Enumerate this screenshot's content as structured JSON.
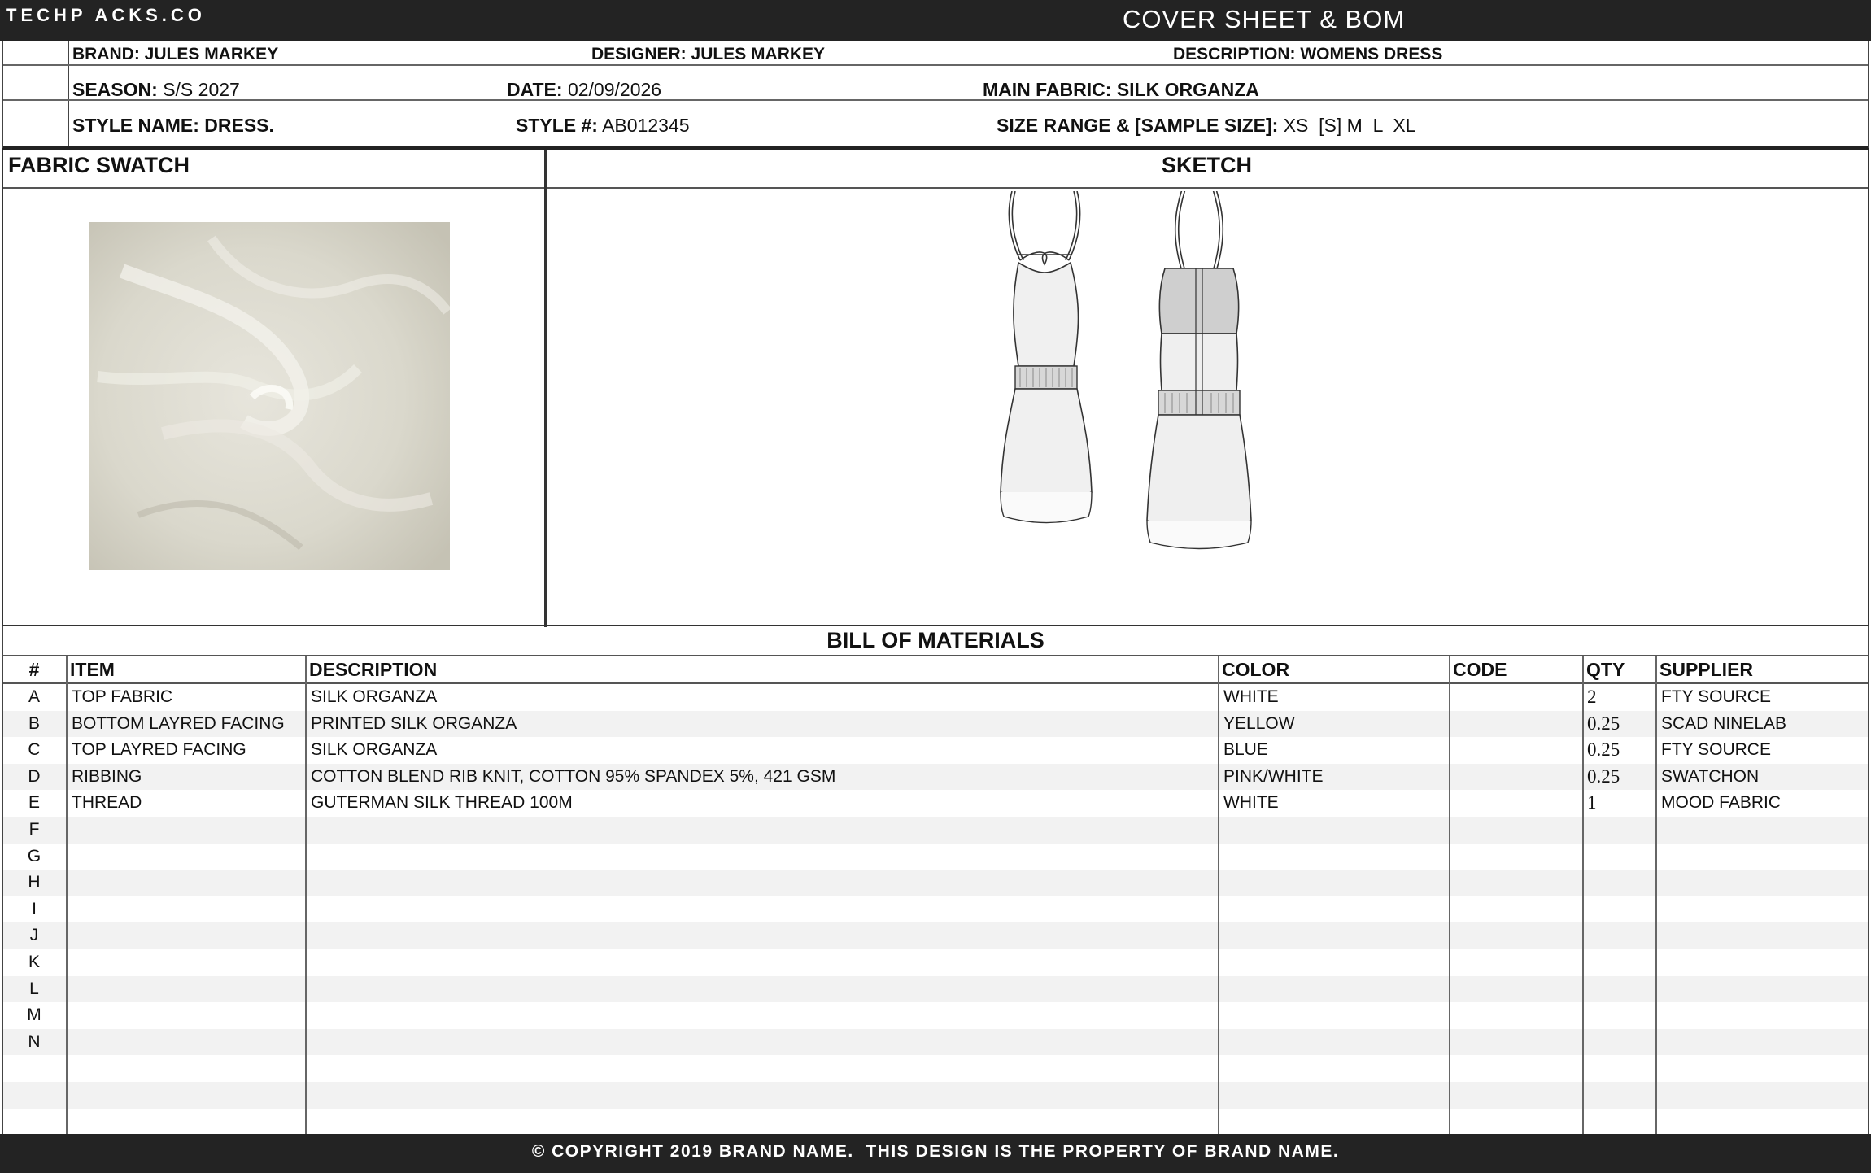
{
  "header": {
    "brand_mark": "TECHP ACKS.CO",
    "title": "COVER SHEET & BOM"
  },
  "info": {
    "brand_label": "BRAND:",
    "brand": "JULES MARKEY",
    "designer_label": "DESIGNER:",
    "designer": "JULES MARKEY",
    "description_label": "DESCRIPTION:",
    "description": "WOMENS DRESS",
    "season_label": "SEASON:",
    "season": "S/S 2027",
    "date_label": "DATE:",
    "date": "02/09/2026",
    "main_fabric_label": "MAIN FABRIC:",
    "main_fabric": "SILK ORGANZA",
    "style_name_label": "STYLE NAME:",
    "style_name": "DRESS.",
    "style_no_label": "STYLE #:",
    "style_no": "AB012345",
    "size_range_label": "SIZE RANGE & [SAMPLE SIZE]:",
    "size_range": "XS  [S] M  L  XL"
  },
  "sections": {
    "swatch": "FABRIC SWATCH",
    "sketch": "SKETCH",
    "bom": "BILL OF MATERIALS"
  },
  "bom": {
    "columns": [
      "#",
      "ITEM",
      "DESCRIPTION",
      "COLOR",
      "CODE",
      "QTY",
      "SUPPLIER"
    ],
    "rows": [
      {
        "id": "A",
        "item": "TOP FABRIC",
        "description": "SILK ORGANZA",
        "color": "WHITE",
        "code": "",
        "qty": "2",
        "supplier": "FTY SOURCE"
      },
      {
        "id": "B",
        "item": "BOTTOM LAYRED FACING",
        "description": "PRINTED SILK ORGANZA",
        "color": "YELLOW",
        "code": "",
        "qty": "0.25",
        "supplier": "SCAD NINELAB"
      },
      {
        "id": "C",
        "item": "TOP LAYRED FACING",
        "description": "SILK ORGANZA",
        "color": "BLUE",
        "code": "",
        "qty": "0.25",
        "supplier": "FTY SOURCE"
      },
      {
        "id": "D",
        "item": "RIBBING",
        "description": "COTTON BLEND RIB KNIT, COTTON 95% SPANDEX 5%, 421 GSM",
        "color": "PINK/WHITE",
        "code": "",
        "qty": "0.25",
        "supplier": "SWATCHON"
      },
      {
        "id": "E",
        "item": "THREAD",
        "description": "GUTERMAN SILK THREAD 100M",
        "color": "WHITE",
        "code": "",
        "qty": "1",
        "supplier": "MOOD FABRIC"
      },
      {
        "id": "F",
        "item": "",
        "description": "",
        "color": "",
        "code": "",
        "qty": "",
        "supplier": ""
      },
      {
        "id": "G",
        "item": "",
        "description": "",
        "color": "",
        "code": "",
        "qty": "",
        "supplier": ""
      },
      {
        "id": "H",
        "item": "",
        "description": "",
        "color": "",
        "code": "",
        "qty": "",
        "supplier": ""
      },
      {
        "id": "I",
        "item": "",
        "description": "",
        "color": "",
        "code": "",
        "qty": "",
        "supplier": ""
      },
      {
        "id": "J",
        "item": "",
        "description": "",
        "color": "",
        "code": "",
        "qty": "",
        "supplier": ""
      },
      {
        "id": "K",
        "item": "",
        "description": "",
        "color": "",
        "code": "",
        "qty": "",
        "supplier": ""
      },
      {
        "id": "L",
        "item": "",
        "description": "",
        "color": "",
        "code": "",
        "qty": "",
        "supplier": ""
      },
      {
        "id": "M",
        "item": "",
        "description": "",
        "color": "",
        "code": "",
        "qty": "",
        "supplier": ""
      },
      {
        "id": "N",
        "item": "",
        "description": "",
        "color": "",
        "code": "",
        "qty": "",
        "supplier": ""
      },
      {
        "id": "",
        "item": "",
        "description": "",
        "color": "",
        "code": "",
        "qty": "",
        "supplier": ""
      },
      {
        "id": "",
        "item": "",
        "description": "",
        "color": "",
        "code": "",
        "qty": "",
        "supplier": ""
      },
      {
        "id": "",
        "item": "",
        "description": "",
        "color": "",
        "code": "",
        "qty": "",
        "supplier": ""
      }
    ]
  },
  "footer": {
    "text": "© COPYRIGHT 2019 BRAND NAME.  THIS DESIGN IS THE PROPERTY OF BRAND NAME."
  },
  "colors": {
    "bar": "#232323",
    "row_alt": "#f2f2f2",
    "swatch_fabric": "#dcdad0"
  }
}
